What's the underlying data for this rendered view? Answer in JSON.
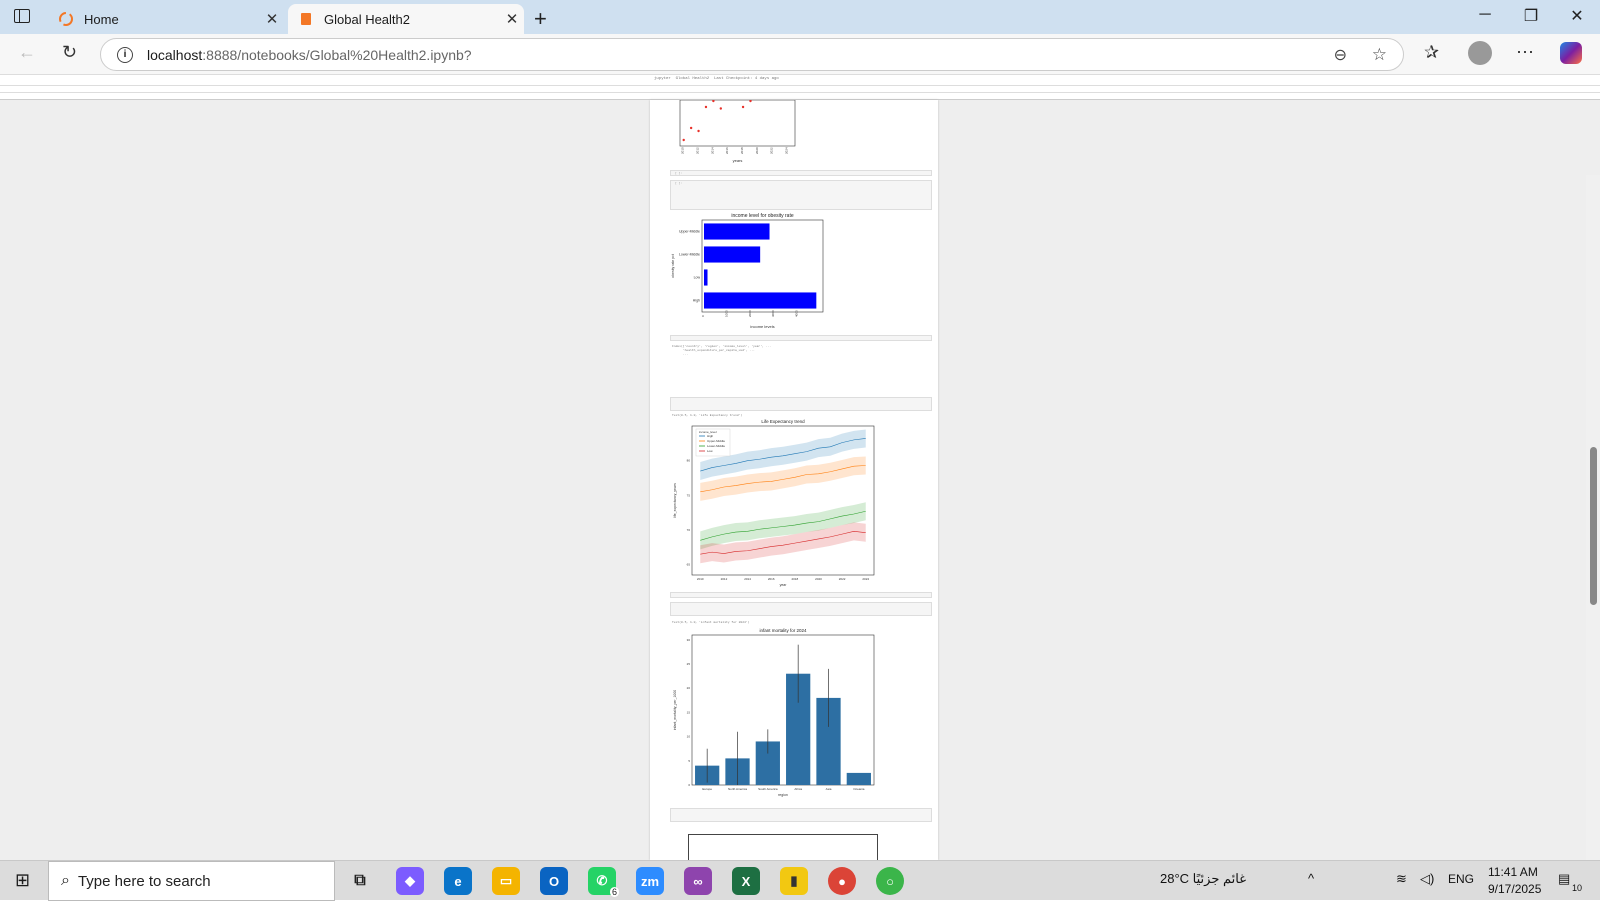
{
  "browser": {
    "tabs": [
      {
        "title": "Home",
        "active": false
      },
      {
        "title": "Global Health2",
        "active": true
      }
    ],
    "new_tab": "+",
    "url_host": "localhost",
    "url_path": ":8888/notebooks/Global%20Health2.ipynb?",
    "window_controls": [
      "minimize-icon",
      "restore-icon",
      "close-icon"
    ]
  },
  "notebook": {
    "header": "jupyter  Global Health2  Last Checkpoint: 4 days ago",
    "cell_out_mortality": "Text(0.5, 1.0, 'infant mortality for 2024')",
    "cell_out_life": "Text(0.5, 1.0, 'Life Expectancy trend')"
  },
  "charts": [
    {
      "type": "scatter",
      "title": "",
      "xlabel": "years",
      "ylabel": "",
      "x": [
        2010,
        2011,
        2012,
        2013,
        2014,
        2015,
        2017,
        2018,
        2019
      ],
      "y": [
        65,
        65.8,
        65.6,
        67.2,
        67.6,
        67.1,
        68.1,
        67.2,
        67.6
      ],
      "color": "#e8312a"
    },
    {
      "type": "bar",
      "title": "income level for obesity rate",
      "xlabel": "income levels",
      "ylabel": "obesity rate pct",
      "categories": [
        "Upper-Middle",
        "Lower-Middle",
        "Low",
        "High"
      ],
      "values": [
        2800,
        2400,
        150,
        4800
      ],
      "xticks": [
        "0",
        "1000",
        "2000",
        "3000",
        "4000"
      ],
      "color": "#0000ff"
    },
    {
      "type": "line",
      "title": "Life Expectancy trend",
      "xlabel": "year",
      "ylabel": "life_expectancy_years",
      "legend_title": "income_level",
      "legend_position": "top-left",
      "x": [
        2010,
        2011,
        2012,
        2013,
        2014,
        2015,
        2016,
        2017,
        2018,
        2019,
        2020,
        2021,
        2022,
        2023,
        2024
      ],
      "xticks": [
        "2010",
        "2012",
        "2014",
        "2016",
        "2018",
        "2020",
        "2022",
        "2024"
      ],
      "yticks": [
        "65",
        "70",
        "75",
        "80"
      ],
      "series": [
        {
          "name": "High",
          "color": "#1f77b4",
          "values": [
            78.5,
            79,
            79.3,
            79.6,
            80,
            80.2,
            80.5,
            80.7,
            81,
            81.3,
            81.8,
            82,
            82.6,
            83,
            83.2
          ]
        },
        {
          "name": "Upper-Middle",
          "color": "#ff7f0e",
          "values": [
            75.5,
            75.8,
            76.2,
            76.4,
            76.7,
            76.9,
            77,
            77.3,
            77.6,
            78,
            78.1,
            78.4,
            78.8,
            79.2,
            79.3
          ]
        },
        {
          "name": "Lower-Middle",
          "color": "#2ca02c",
          "values": [
            68.5,
            69,
            69.4,
            69.7,
            69.8,
            70.1,
            70.3,
            70.5,
            70.7,
            71,
            71.2,
            71.6,
            72,
            72.3,
            72.7
          ]
        },
        {
          "name": "Low",
          "color": "#d62728",
          "values": [
            66.5,
            66.8,
            66.6,
            66.9,
            67,
            67.3,
            67.6,
            67.8,
            68.1,
            68.4,
            68.7,
            69,
            69.4,
            69.8,
            69.6
          ]
        }
      ]
    },
    {
      "type": "bar",
      "title": "infant mortality for 2024",
      "xlabel": "region",
      "ylabel": "infant_mortality_per_1000",
      "categories": [
        "Europe",
        "North America",
        "South America",
        "Africa",
        "Asia",
        "Oceania"
      ],
      "values": [
        4,
        5.5,
        9,
        23,
        18,
        2.5
      ],
      "errors": [
        3.5,
        5.5,
        2.5,
        6,
        6,
        0
      ],
      "yticks": [
        "0",
        "5",
        "10",
        "15",
        "20",
        "25",
        "30"
      ],
      "ylim": [
        0,
        31
      ],
      "color": "#2d6fa3"
    }
  ],
  "taskbar": {
    "search_placeholder": "Type here to search",
    "weather": "28°C  غائم جزئيًا",
    "language": "ENG",
    "time": "11:41 AM",
    "date": "9/17/2025",
    "notifications": "10",
    "whatsapp_badge": "6"
  }
}
